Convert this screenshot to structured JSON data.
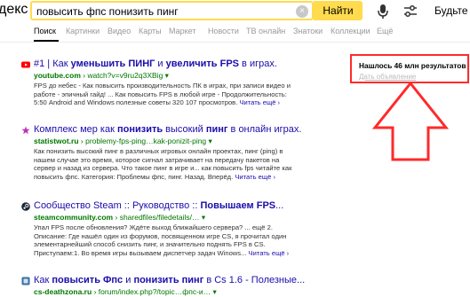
{
  "header": {
    "logo_text": "декс",
    "search_value": "повысить фпс понизить пинг",
    "clear_symbol": "×",
    "find_label": "Найти",
    "login_label": "Будьте в"
  },
  "tabs": [
    "Поиск",
    "Картинки",
    "Видео",
    "Карты",
    "Маркет",
    "Новости",
    "ТВ онлайн",
    "Знатоки",
    "Коллекции",
    "Ещё"
  ],
  "results": [
    {
      "title_parts": [
        "#1 | Как ",
        "уменьшить ПИНГ",
        " и ",
        "увеличить FPS",
        " в играх."
      ],
      "domain": "youtube.com",
      "path": "› watch?v=v9ru2q3XBig ▾",
      "snippet": "FPS до небес - Как повысить производительность ПК в играх, при записи видео и работе - эпичный гайд! ... Как повысить FPS в любой игре - Продолжительность: 5:50 Android and Windows полезные советы 320 107 просмотров.",
      "more": "Читать ещё ›"
    },
    {
      "title_parts": [
        "Комплекс мер как ",
        "понизить",
        " высокий ",
        "пинг",
        " в онлайн играх."
      ],
      "domain": "statistwot.ru",
      "path": "› problemy-fps-ping…kak-ponizit-ping ▾",
      "snippet": "Как понизить высокий пинг в различных игровых онлайн проектах, пинг (ping) в нашем случае это время, которое сигнал затрачивает на передачу пакетов на сервер и назад из сервера. Что такое пинг в игре и... как повысить fps читайте как повысить фпс. Категория: Проблемы фпс, пинг. Назад. Вперёд.",
      "more": "Читать ещё ›"
    },
    {
      "title_parts": [
        "Сообщество Steam :: Руководство :: ",
        "Повышаем FPS",
        "..."
      ],
      "domain": "steamcommunity.com",
      "path": "› sharedfiles/filedetails/… ▾",
      "snippet": "Упал FPS после обновления? Ждёте выход ближайшего сервера? ... ещё 2. Описание: Где нашёл один из форумов, посвященном игре CS, я прочитал один элементарнейший способ снизить пинг, и значительно поднять FPS в CS. Приступаем:1. Во время игры вызываем диспетчер задач Winows...",
      "more": "Читать ещё ›"
    },
    {
      "title_parts": [
        "Как ",
        "повысить Фпс",
        " и ",
        "понизить пинг",
        " в Cs 1.6 - Полезные..."
      ],
      "domain": "cs-deathzona.ru",
      "path": "› forum/index.php?/topic…фпс-и… ▾",
      "snippet": "",
      "more": ""
    }
  ],
  "sidebar": {
    "results_count": "Нашлось 46 млн результатов",
    "ad_link": "Дать объявление"
  },
  "colors": {
    "accent": "#ffdb4d",
    "link": "#1a0dab",
    "url_green": "#007700",
    "highlight_red": "#ff2a2a"
  },
  "icons": [
    "youtube-icon",
    "star-icon",
    "steam-icon",
    "site-icon",
    "mic-icon",
    "filter-icon"
  ]
}
